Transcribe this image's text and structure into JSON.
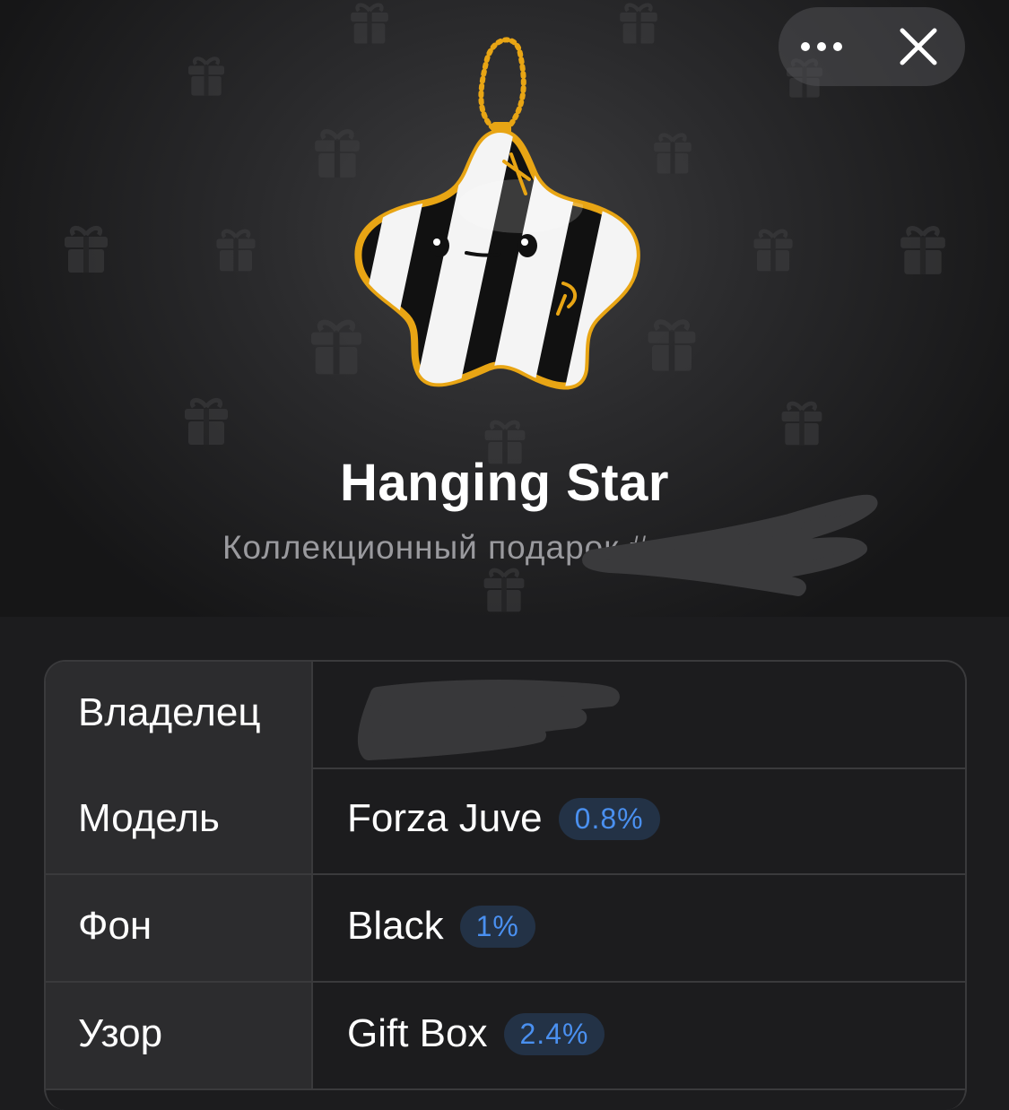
{
  "header": {
    "more_icon": "more-dots-icon",
    "close_icon": "close-x-icon"
  },
  "gift": {
    "title": "Hanging Star",
    "subtitle": "Коллекционный подарок #",
    "image_icon": "hanging-star-gift-icon"
  },
  "attributes": [
    {
      "label": "Владелец",
      "value": "",
      "rarity": ""
    },
    {
      "label": "Модель",
      "value": "Forza Juve",
      "rarity": "0.8%"
    },
    {
      "label": "Фон",
      "value": "Black",
      "rarity": "1%"
    },
    {
      "label": "Узор",
      "value": "Gift Box",
      "rarity": "2.4%"
    }
  ],
  "colors": {
    "background": "#1c1c1e",
    "table_label_bg": "#2c2c2e",
    "badge_text": "#4a90f0",
    "badge_bg": "#233246",
    "star_gold": "#e8a514"
  }
}
